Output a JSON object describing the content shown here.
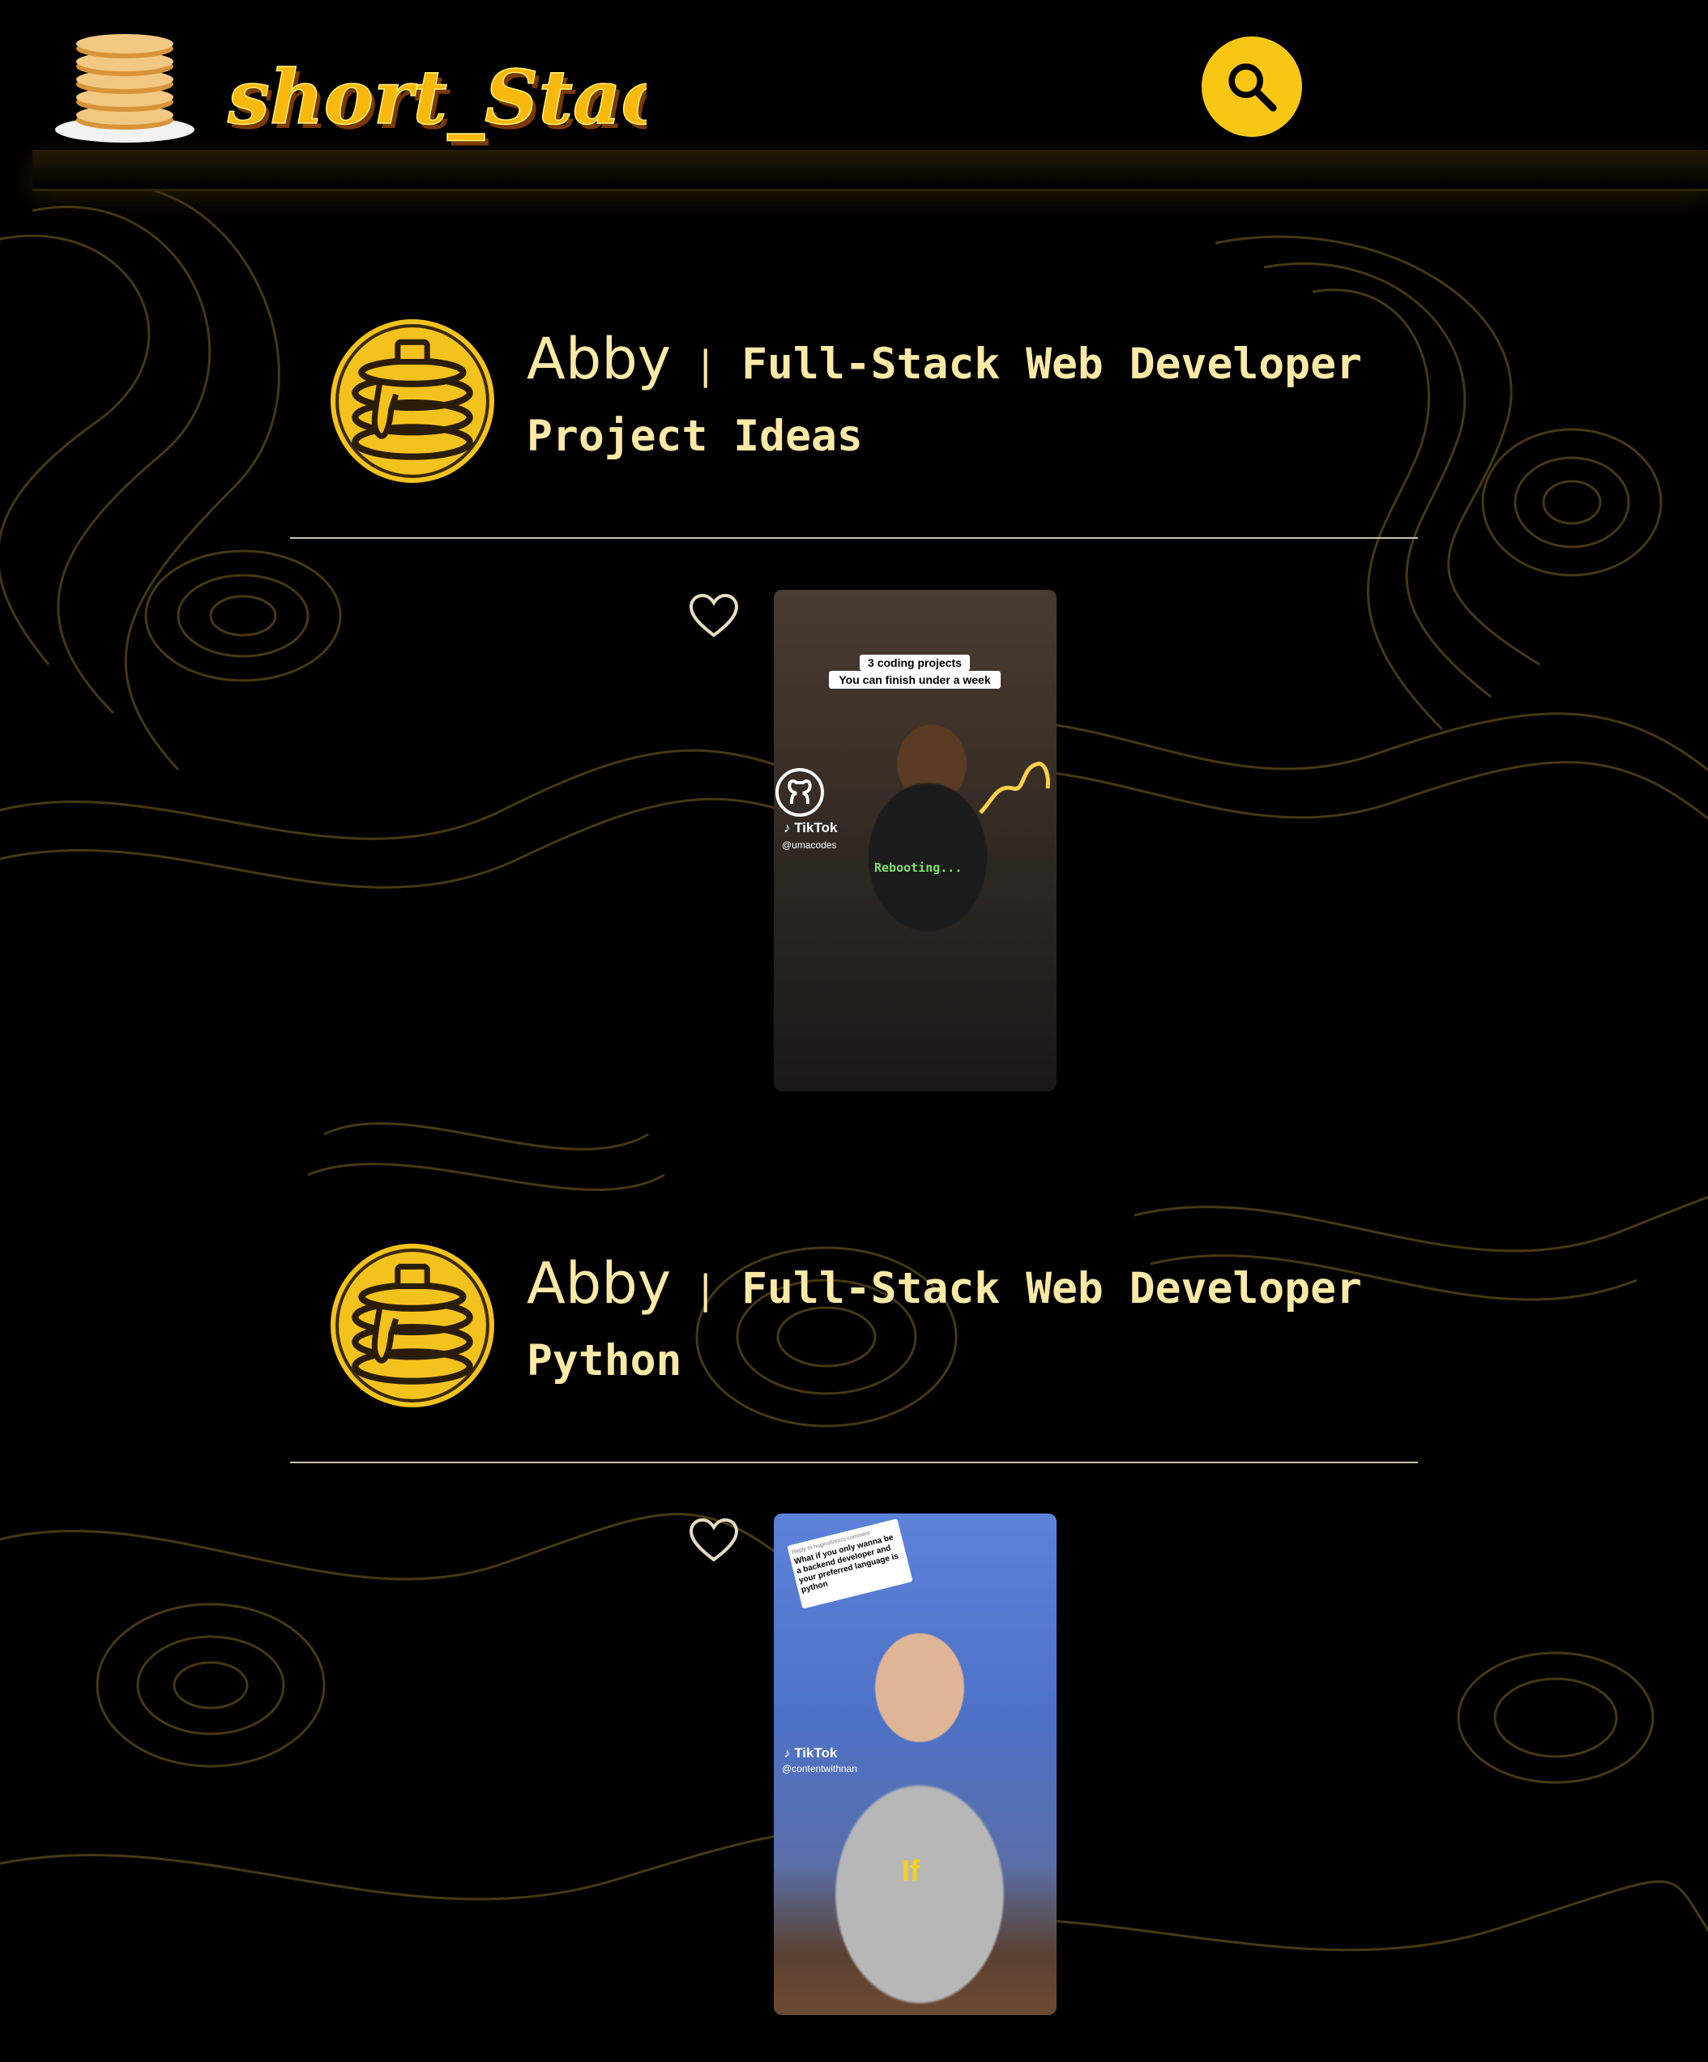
{
  "header": {
    "logo_text": "short_Stack",
    "search_label": "search"
  },
  "posts": [
    {
      "author": "Abby",
      "separator": "|",
      "role": "Full-Stack Web Developer",
      "topic": "Project Ideas",
      "liked": false,
      "video": {
        "caption_line1": "3 coding projects",
        "caption_line2": "You can finish under a week",
        "platform": "TikTok",
        "handle": "@umacodes",
        "shirt_text": "Rebooting..."
      }
    },
    {
      "author": "Abby",
      "separator": "|",
      "role": "Full-Stack Web Developer",
      "topic": "Python",
      "liked": false,
      "video": {
        "reply_header": "Reply to huginsfinnn's comment",
        "reply_text": "What if you only wanna be a backend developer and your preferred language is python",
        "platform": "TikTok",
        "handle": "@contentwithnan",
        "subtitle": "If"
      }
    }
  ],
  "colors": {
    "accent": "#f9c713",
    "text": "#fde9a6",
    "background": "#000000",
    "topo_lines": "#5a4716"
  }
}
